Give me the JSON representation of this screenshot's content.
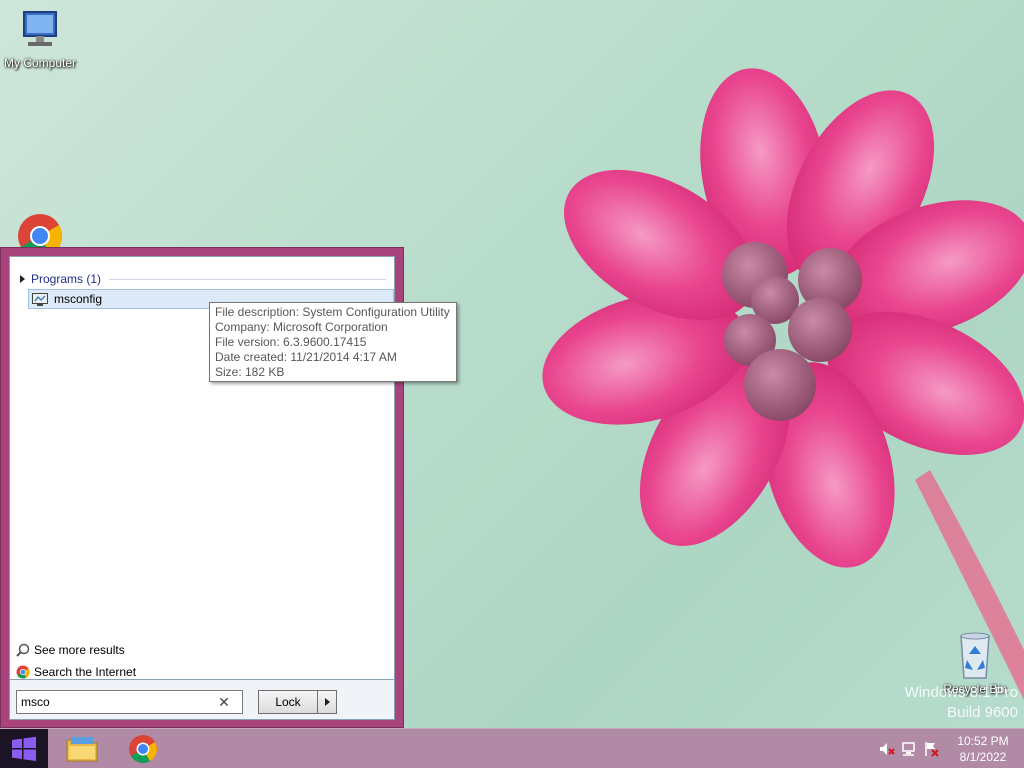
{
  "desktop": {
    "icons": [
      {
        "label": "My Computer",
        "icon": "my-computer-icon"
      },
      {
        "label": "",
        "icon": "chrome-icon"
      },
      {
        "label": "Recycle Bin",
        "icon": "recycle-bin-icon"
      }
    ],
    "watermark": {
      "line1": "Windows 8.1 Pro",
      "line2": "Build 9600"
    }
  },
  "start_menu": {
    "group_header": "Programs (1)",
    "results": [
      {
        "label": "msconfig",
        "icon": "msconfig-icon"
      }
    ],
    "tooltip": {
      "description": "File description: System Configuration Utility",
      "company": "Company: Microsoft Corporation",
      "version": "File version: 6.3.9600.17415",
      "date": "Date created: 11/21/2014 4:17 AM",
      "size": "Size: 182 KB"
    },
    "see_more": "See more results",
    "search_internet": "Search the Internet",
    "search": {
      "value": "msco",
      "placeholder": ""
    },
    "lock_label": "Lock",
    "accent_color": "#a8437c"
  },
  "taskbar": {
    "apps": [
      {
        "name": "file-explorer",
        "icon": "folder-icon"
      },
      {
        "name": "chrome",
        "icon": "chrome-icon"
      }
    ],
    "clock": {
      "time": "10:52 PM",
      "date": "8/1/2022"
    },
    "color": "#b18aa6"
  }
}
